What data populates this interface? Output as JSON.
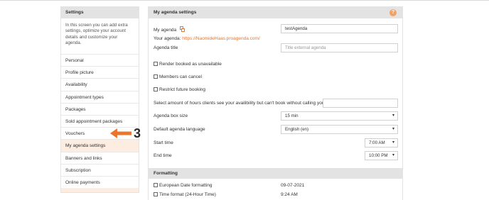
{
  "sidebar": {
    "title": "Settings",
    "description": "In this screen you can add extra settings, optimize your account details and customize your agenda.",
    "items": [
      {
        "label": "Personal"
      },
      {
        "label": "Profile picture"
      },
      {
        "label": "Availability"
      },
      {
        "label": "Appointment types"
      },
      {
        "label": "Packages"
      },
      {
        "label": "Sold appointment packages"
      },
      {
        "label": "Vouchers"
      },
      {
        "label": "My agenda settings",
        "active": true
      },
      {
        "label": "Banners and links"
      },
      {
        "label": "Subscription"
      },
      {
        "label": "Online payments"
      }
    ]
  },
  "annotation": {
    "number": "3",
    "color": "#e8762d"
  },
  "main": {
    "title": "My agenda settings",
    "help_icon": "?",
    "my_agenda_label": "My agenda",
    "my_agenda_value": "testAgenda",
    "your_agenda_label": "Your agenda:",
    "your_agenda_link": "https://NaomideHaas.proagenda.com/",
    "agenda_title_label": "Agenda title",
    "agenda_title_placeholder": "Title external agenda",
    "render_booked_label": "Render booked as unavailable",
    "members_cancel_label": "Members can cancel",
    "restrict_future_label": "Restrict future booking",
    "hours_notice_label": "Select amount of hours clients see your availibility but can't book without calling you",
    "hours_notice_value": "",
    "box_size_label": "Agenda box size",
    "box_size_value": "15 min",
    "language_label": "Default agenda language",
    "language_value": "English (en)",
    "start_time_label": "Start time",
    "start_time_value": "7:00 AM",
    "end_time_label": "End time",
    "end_time_value": "10:00 PM"
  },
  "formatting": {
    "title": "Formatting",
    "european_date_label": "European Date formatting",
    "european_date_value": "09-07-2021",
    "time_format_label": "Time format (24-Hour Time)",
    "time_format_value": "9:24 AM"
  },
  "colors": {
    "accent": "#e8762d",
    "header_bg": "#e3e3e3",
    "active_bg": "#fdece0"
  }
}
